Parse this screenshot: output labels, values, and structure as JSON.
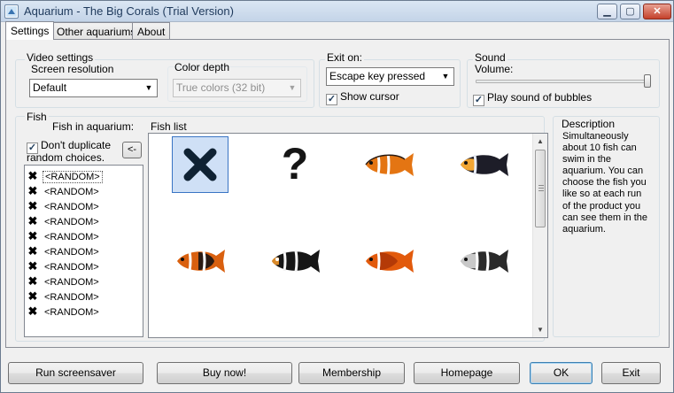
{
  "window": {
    "title": "Aquarium - The Big Corals (Trial Version)",
    "min_glyph": "▁",
    "max_glyph": "▢",
    "close_glyph": "✕"
  },
  "tabs": [
    {
      "label": "Settings"
    },
    {
      "label": "Other aquariums"
    },
    {
      "label": "About"
    }
  ],
  "video": {
    "group_label": "Video settings",
    "resolution_label": "Screen resolution",
    "resolution_value": "Default",
    "depth_label": "Color depth",
    "depth_value": "True colors (32 bit)"
  },
  "exit": {
    "group_label": "Exit on:",
    "value": "Escape key pressed",
    "show_cursor_label": "Show cursor",
    "show_cursor_checked": true
  },
  "sound": {
    "group_label": "Sound",
    "volume_label": "Volume:",
    "volume_level": 1.0,
    "bubbles_label": "Play sound of bubbles",
    "bubbles_checked": true
  },
  "fish": {
    "group_label": "Fish",
    "in_aquarium_label": "Fish in aquarium:",
    "dont_duplicate_line1": "Don't duplicate",
    "dont_duplicate_line2": "random choices.",
    "dont_duplicate_checked": true,
    "move_button": "<-",
    "items": [
      "<RANDOM>",
      "<RANDOM>",
      "<RANDOM>",
      "<RANDOM>",
      "<RANDOM>",
      "<RANDOM>",
      "<RANDOM>",
      "<RANDOM>",
      "<RANDOM>",
      "<RANDOM>"
    ],
    "list_label": "Fish list",
    "list_icons": [
      "remove-icon",
      "question-mark-icon",
      "clownfish-icon",
      "clownfish-icon",
      "clownfish-icon",
      "clownfish-icon",
      "clownfish-icon",
      "clownfish-icon"
    ]
  },
  "description": {
    "label": "Description",
    "lines": [
      "Simultaneously",
      "about 10 fish can",
      "swim in the",
      "aquarium. You can",
      "choose the fish you",
      "like so at each run",
      "of the product you",
      "can see them in the",
      "aquarium."
    ]
  },
  "buttons": {
    "run": "Run screensaver",
    "buy": "Buy now!",
    "membership": "Membership",
    "homepage": "Homepage",
    "ok": "OK",
    "exit": "Exit"
  },
  "colors": {
    "accent": "#3c7fb1",
    "fish_orange": "#e06a10",
    "fish_dark": "#1c1c1c"
  }
}
